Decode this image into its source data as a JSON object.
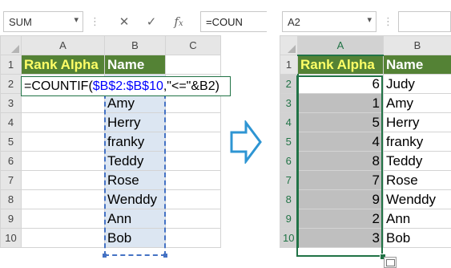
{
  "left": {
    "namebox": "SUM",
    "formula_buttons": [
      "✕",
      "✓",
      "fx"
    ],
    "formula_bar_text": "=COUN",
    "columns": [
      "A",
      "B",
      "C"
    ],
    "rows": [
      "1",
      "2",
      "3",
      "4",
      "5",
      "6",
      "7",
      "8",
      "9",
      "10"
    ],
    "header_a": "Rank Alpha",
    "header_b": "Name",
    "formula": {
      "p1": "=COUNTIF(",
      "p2": "$B$2:$B$10",
      "p3": ",\"<=\"&",
      "p4": "B2",
      "p5": ")"
    },
    "names": [
      "Amy",
      "Herry",
      "franky",
      "Teddy",
      "Rose",
      "Wenddy",
      "Ann",
      "Bob"
    ]
  },
  "right": {
    "namebox": "A2",
    "columns": [
      "A",
      "B"
    ],
    "rows": [
      "1",
      "2",
      "3",
      "4",
      "5",
      "6",
      "7",
      "8",
      "9",
      "10"
    ],
    "header_a": "Rank Alpha",
    "header_b": "Name",
    "ranks": [
      "6",
      "1",
      "5",
      "4",
      "8",
      "7",
      "9",
      "2",
      "3"
    ],
    "names": [
      "Judy",
      "Amy",
      "Herry",
      "franky",
      "Teddy",
      "Rose",
      "Wenddy",
      "Ann",
      "Bob"
    ]
  },
  "colors": {
    "header_green": "#548235",
    "header_yellow_text": "#ffff66",
    "range_blue": "#dce6f2",
    "select_green": "#217346",
    "gray_fill": "#bfbfbf"
  },
  "icons": [
    "dropdown-icon",
    "cancel-icon",
    "enter-icon",
    "insert-function-icon",
    "right-arrow-icon",
    "paste-options-icon",
    "select-all-icon"
  ]
}
